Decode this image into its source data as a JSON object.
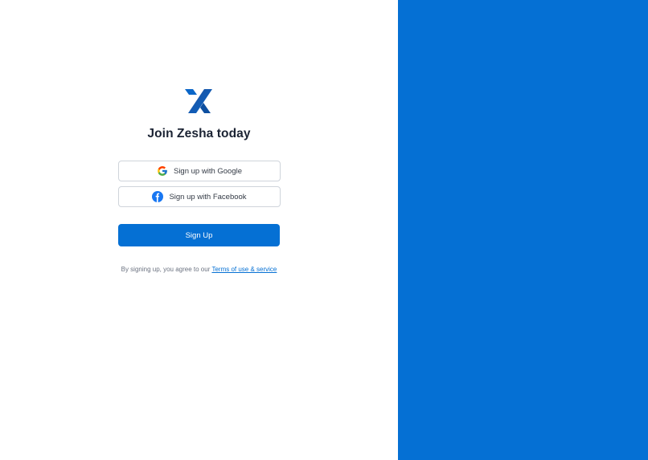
{
  "brand": {
    "logo_icon": "zesha-logo-icon",
    "accent_color": "#0570d4"
  },
  "signup": {
    "title": "Join Zesha today",
    "google_label": "Sign up with Google",
    "google_icon": "google-icon",
    "facebook_label": "Sign up with Facebook",
    "facebook_icon": "facebook-icon",
    "signup_button_label": "Sign Up",
    "terms_prefix": "By signing up, you agree to our",
    "terms_link": "Terms of use & service"
  }
}
